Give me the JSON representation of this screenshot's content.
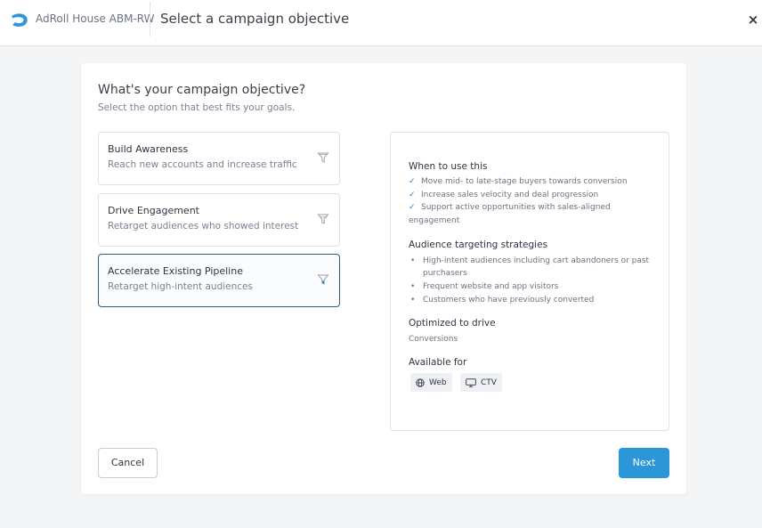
{
  "header": {
    "account_name": "AdRoll House ABM-RW",
    "page_title": "Select a campaign objective",
    "close_symbol": "×",
    "brand_color": "#2c97d8"
  },
  "question": {
    "title": "What's your campaign objective?",
    "subtitle": "Select the option that best fits your goals."
  },
  "options": [
    {
      "title": "Build Awareness",
      "description": "Reach new accounts and increase traffic",
      "selected": false,
      "icon": "funnel-icon"
    },
    {
      "title": "Drive Engagement",
      "description": "Retarget audiences who showed interest",
      "selected": false,
      "icon": "funnel-icon"
    },
    {
      "title": "Accelerate Existing Pipeline",
      "description": "Retarget high-intent audiences",
      "selected": true,
      "icon": "funnel-icon"
    }
  ],
  "detail": {
    "when_heading": "When to use this",
    "when_items": [
      "Move mid- to late-stage buyers towards conversion",
      "Increase sales velocity and deal progression",
      "Support active opportunities with sales-aligned",
      "engagement"
    ],
    "strategies_heading": "Audience targeting strategies",
    "strategies_items": [
      "High-intent audiences including cart abandoners or past",
      "purchasers",
      "Frequent website and app visitors",
      "Customers who have previously converted"
    ],
    "optimized_heading": "Optimized to drive",
    "optimized_value": "Conversions",
    "available_heading": "Available for",
    "channels": [
      {
        "label": "Web",
        "icon": "globe-icon"
      },
      {
        "label": "CTV",
        "icon": "monitor-icon"
      }
    ]
  },
  "actions": {
    "cancel_label": "Cancel",
    "next_label": "Next"
  }
}
